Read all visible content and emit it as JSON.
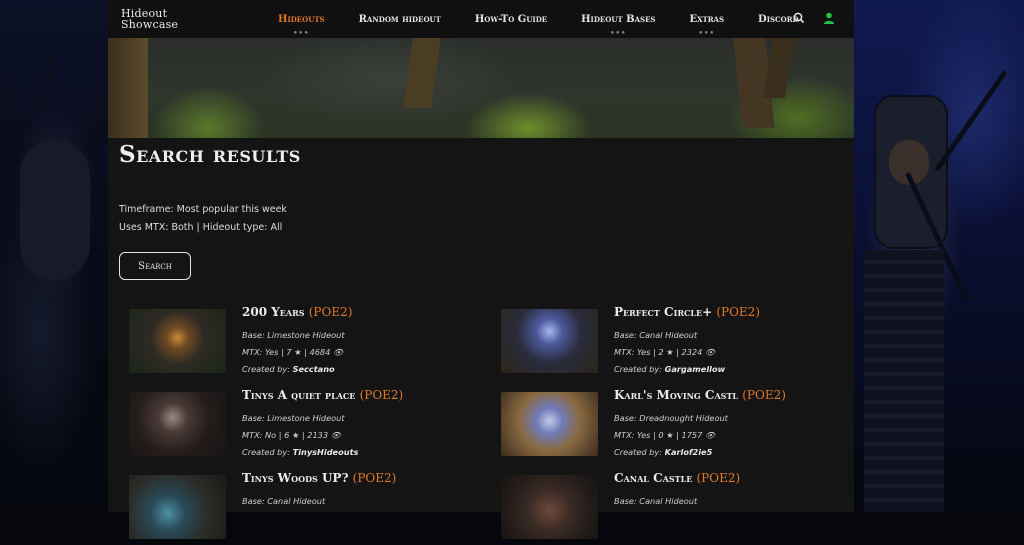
{
  "header": {
    "logo_line1": "Hideout",
    "logo_line2": "Showcase",
    "nav": [
      {
        "label": "Hideouts",
        "active": true,
        "has_dropdown": true
      },
      {
        "label": "Random hideout",
        "active": false,
        "has_dropdown": false
      },
      {
        "label": "How-To Guide",
        "active": false,
        "has_dropdown": false
      },
      {
        "label": "Hideout Bases",
        "active": false,
        "has_dropdown": true
      },
      {
        "label": "Extras",
        "active": false,
        "has_dropdown": true
      },
      {
        "label": "Discord",
        "active": false,
        "has_dropdown": false
      }
    ],
    "dropdown_marker": "•••",
    "icons": [
      "search-icon",
      "user-icon"
    ]
  },
  "page": {
    "title": "Search results",
    "filters_line1": "Timeframe: Most popular this week",
    "filters_line2": "Uses MTX: Both  |  Hideout type: All",
    "search_button": "Search"
  },
  "results": [
    {
      "name": "200 Years",
      "tag": "(POE2)",
      "base": "Base: Limestone Hideout",
      "stats": "MTX: Yes  |  7 ★  |  4684 👁",
      "created_label": "Created by:",
      "creator": "Secctano"
    },
    {
      "name": "Perfect Circle+",
      "tag": "(POE2)",
      "base": "Base: Canal Hideout",
      "stats": "MTX: Yes  |  2 ★  |  2324 👁",
      "created_label": "Created by:",
      "creator": "Gargamellow"
    },
    {
      "name": "Tinys A quiet place",
      "tag": "(POE2)",
      "base": "Base: Limestone Hideout",
      "stats": "MTX: No  |  6 ★  |  2133 👁",
      "created_label": "Created by:",
      "creator": "TinysHideouts"
    },
    {
      "name": "Karl's Moving Castl",
      "tag": "(POE2)",
      "base": "Base: Dreadnought Hideout",
      "stats": "MTX: Yes  |  0 ★  |  1757 👁",
      "created_label": "Created by:",
      "creator": "Karlof2ie5"
    },
    {
      "name": "Tinys Woods UP?",
      "tag": "(POE2)",
      "base": "Base: Canal Hideout",
      "stats": "",
      "created_label": "",
      "creator": ""
    },
    {
      "name": "Canal Castle",
      "tag": "(POE2)",
      "base": "Base: Canal Hideout",
      "stats": "",
      "created_label": "",
      "creator": ""
    }
  ],
  "colors": {
    "accent": "#e07a28",
    "panel": "#141414",
    "header": "#101010",
    "user_icon": "#23c04a"
  }
}
